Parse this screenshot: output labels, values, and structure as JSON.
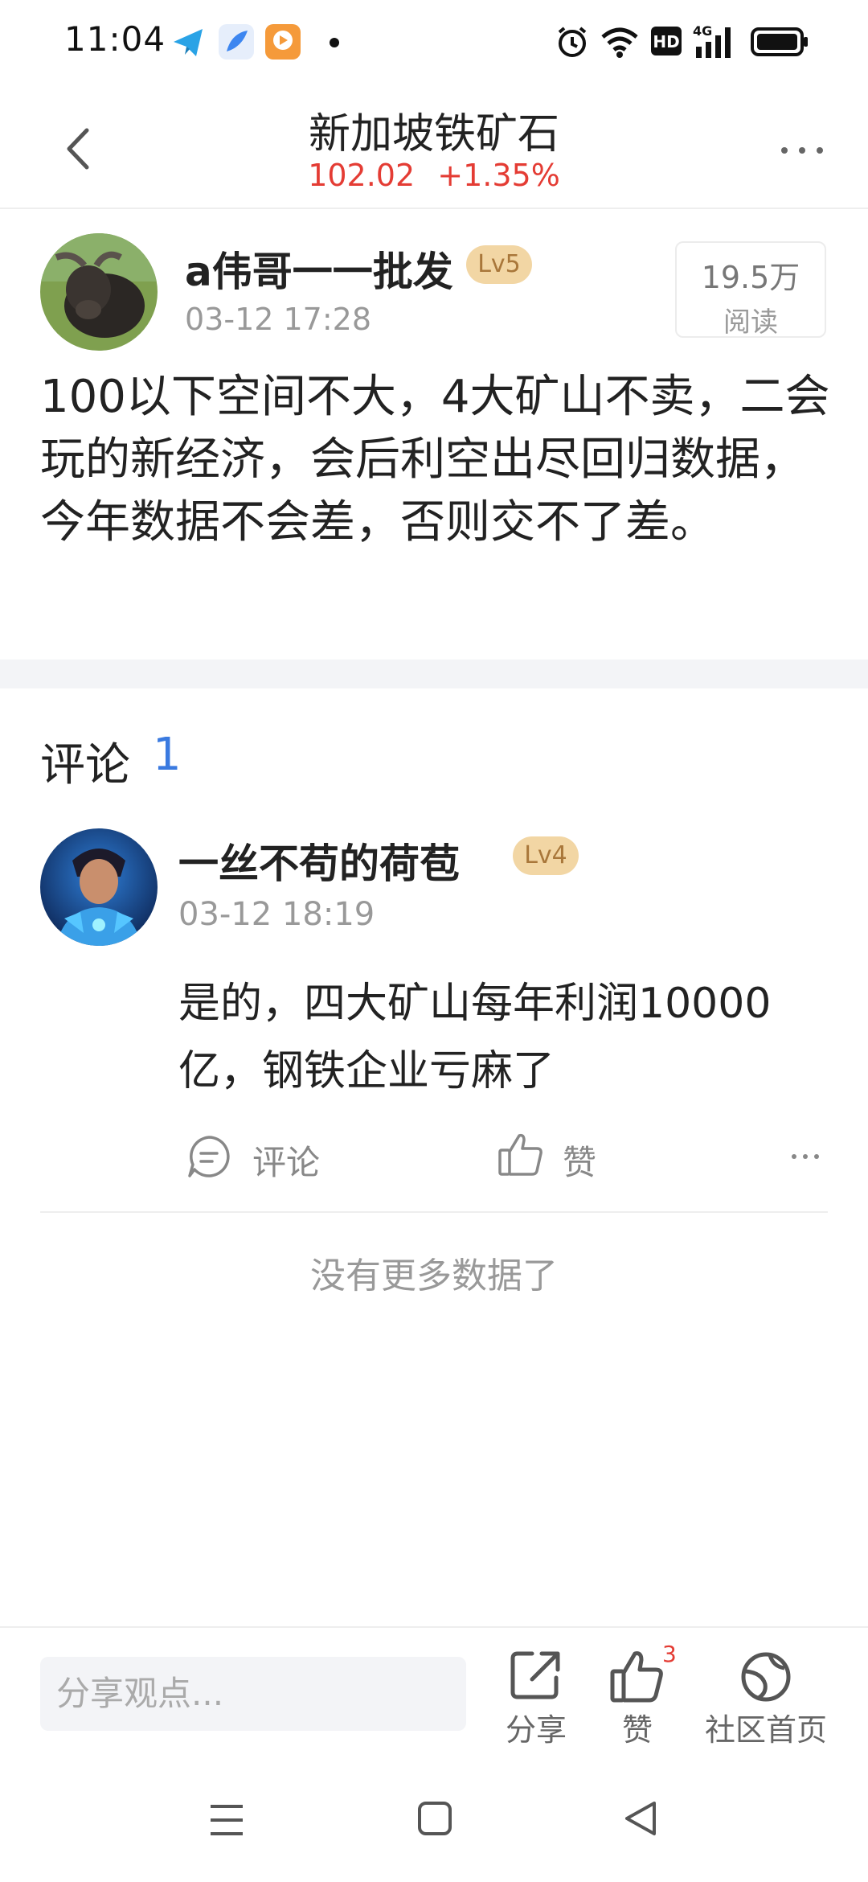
{
  "status_bar": {
    "time": "11:04"
  },
  "header": {
    "title": "新加坡铁矿石",
    "price": "102.02",
    "change": "+1.35%",
    "price_color": "#e43c34"
  },
  "post": {
    "author": "a伟哥一一批发",
    "level": "Lv5",
    "time": "03-12 17:28",
    "reads_count": "19.5万",
    "reads_label": "阅读",
    "body": "100以下空间不大，4大矿山不卖，二会玩的新经济，会后利空出尽回归数据，今年数据不会差，否则交不了差。"
  },
  "comments_section": {
    "title": "评论",
    "count": "1",
    "items": [
      {
        "author": "一丝不苟的荷苞",
        "level": "Lv4",
        "time": "03-12 18:19",
        "body": "是的，四大矿山每年利润10000亿，钢铁企业亏麻了",
        "reply_label": "评论",
        "like_label": "赞"
      }
    ],
    "end_text": "没有更多数据了"
  },
  "bottom_bar": {
    "input_placeholder": "分享观点...",
    "share_label": "分享",
    "like_label": "赞",
    "like_count": "3",
    "community_label": "社区首页"
  },
  "colors": {
    "accent_blue": "#3a7ae0",
    "level_badge_bg": "#f2d6a4"
  }
}
